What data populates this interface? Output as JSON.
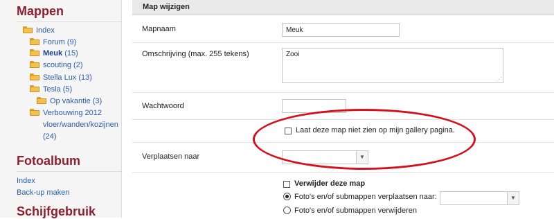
{
  "sidebar": {
    "mappen_title": "Mappen",
    "tree": [
      {
        "label": "Index",
        "count": ""
      },
      {
        "label": "Forum",
        "count": "(9)"
      },
      {
        "label": "Meuk",
        "count": "(15)"
      },
      {
        "label": "scouting",
        "count": "(2)"
      },
      {
        "label": "Stella Lux",
        "count": "(13)"
      },
      {
        "label": "Tesla",
        "count": "(5)"
      },
      {
        "label": "Op vakantie",
        "count": "(3)"
      },
      {
        "label": "Verbouwing 2012",
        "line2": "vloer/wanden/kozijnen",
        "count": "(24)"
      }
    ],
    "fotoalbum_title": "Fotoalbum",
    "fotoalbum_links": [
      "Index",
      "Back-up maken"
    ],
    "schijf_title": "Schijfgebruik"
  },
  "form": {
    "header": "Map wijzigen",
    "mapnaam_label": "Mapnaam",
    "mapnaam_value": "Meuk",
    "omschrijving_label": "Omschrijving (max. 255 tekens)",
    "omschrijving_value": "Zooi",
    "wachtwoord_label": "Wachtwoord",
    "wachtwoord_value": "",
    "hide_label": "Laat deze map niet zien op mijn gallery pagina.",
    "verplaatsen_label": "Verplaatsen naar",
    "verplaatsen_value": "",
    "delete_label": "Verwijder deze map",
    "option_move_label": "Foto's en/of submappen verplaatsen naar:",
    "option_move_value": "",
    "option_delete_label": "Foto's en/of submappen verwijderen"
  },
  "colors": {
    "section_title": "#8e1f2f",
    "link": "#2a5db0",
    "highlight_ellipse": "#d4101c"
  }
}
